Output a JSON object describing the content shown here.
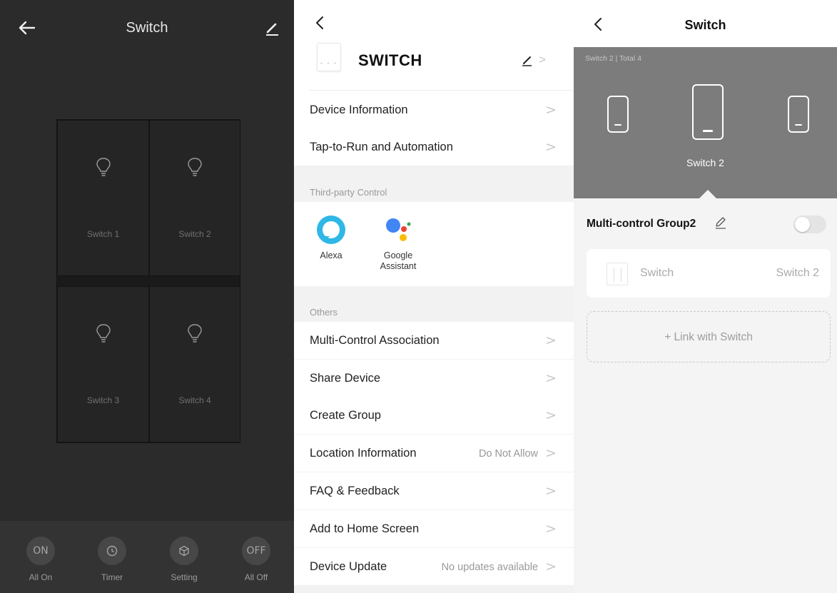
{
  "panel1": {
    "title": "Switch",
    "switches": [
      {
        "label": "Switch 1"
      },
      {
        "label": "Switch 2"
      },
      {
        "label": "Switch 3"
      },
      {
        "label": "Switch 4"
      }
    ],
    "actions": [
      {
        "icon_text": "ON",
        "label": "All On",
        "icon": "on-icon"
      },
      {
        "icon_text": "",
        "label": "Timer",
        "icon": "clock-icon"
      },
      {
        "icon_text": "",
        "label": "Setting",
        "icon": "cube-icon"
      },
      {
        "icon_text": "OFF",
        "label": "All Off",
        "icon": "off-icon"
      }
    ]
  },
  "panel2": {
    "device_name": "SWITCH",
    "rows_top": [
      {
        "label": "Device Information",
        "value": ""
      },
      {
        "label": "Tap-to-Run and Automation",
        "value": ""
      }
    ],
    "third_party_header": "Third-party Control",
    "third_party": [
      {
        "label_line1": "Alexa",
        "label_line2": ""
      },
      {
        "label_line1": "Google",
        "label_line2": "Assistant"
      }
    ],
    "others_header": "Others",
    "rows_others": [
      {
        "label": "Multi-Control Association",
        "value": ""
      },
      {
        "label": "Share Device",
        "value": ""
      },
      {
        "label": "Create Group",
        "value": ""
      },
      {
        "label": "Location Information",
        "value": "Do Not Allow"
      },
      {
        "label": "FAQ & Feedback",
        "value": ""
      },
      {
        "label": "Add to Home Screen",
        "value": ""
      },
      {
        "label": "Device Update",
        "value": "No updates available"
      }
    ],
    "chevron": ">"
  },
  "panel3": {
    "title": "Switch",
    "switch_count": "Switch 2 | Total 4",
    "selected_switch": "Switch 2",
    "group_name": "Multi-control Group2",
    "group_enabled": false,
    "linked": {
      "device": "Switch",
      "channel": "Switch 2"
    },
    "link_button": "+ Link with Switch"
  },
  "colors": {
    "dark_bg": "#2b2b2b",
    "banner_bg": "#7c7c7c",
    "alexa": "#2fb7e6",
    "google_blue": "#4285f4",
    "google_red": "#ea4335",
    "google_yellow": "#fbbc05",
    "google_green": "#34a853"
  }
}
